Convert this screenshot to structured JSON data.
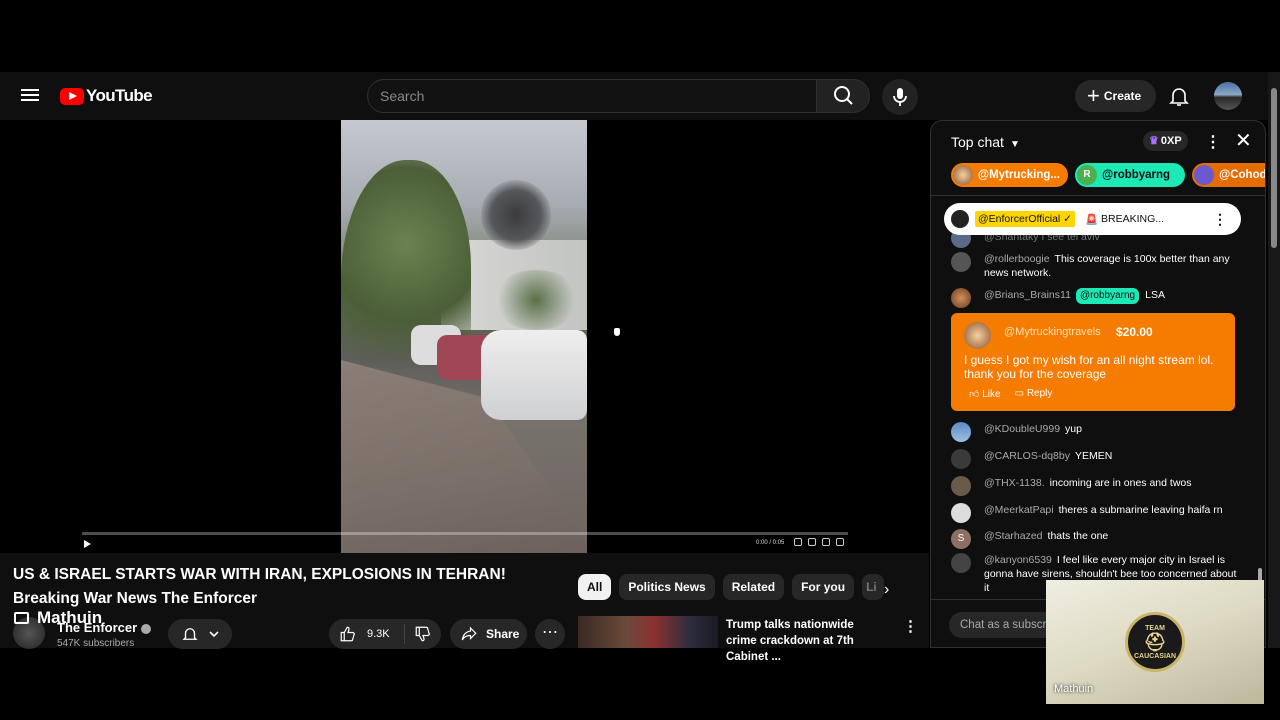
{
  "header": {
    "logo_text": "YouTube",
    "search_placeholder": "Search",
    "create_label": "Create"
  },
  "player": {
    "time": "0:00 / 0:05"
  },
  "video": {
    "title_line1": "US & ISRAEL STARTS WAR WITH IRAN, EXPLOSIONS IN TEHRAN!",
    "title_line2": "Breaking War News The Enforcer",
    "overlay_name": "Mathuin",
    "channel_name": "The Enforcer",
    "subscribers": "547K subscribers",
    "likes": "9.3K",
    "share_label": "Share"
  },
  "related": {
    "chips": [
      "All",
      "Politics News",
      "Related",
      "For you",
      "Li"
    ],
    "first_title": "Trump talks nationwide crime crackdown at 7th Cabinet ..."
  },
  "chat": {
    "title": "Top chat",
    "xp": "0XP",
    "tickers": [
      "@Mytrucking...",
      "@robbyarng",
      "@Cohode"
    ],
    "ticker_initial": "R",
    "pinned": {
      "author": "@EnforcerOfficial ✓",
      "text": "BREAKING..."
    },
    "partial_msg": "@Shantaky  I see tel aviv",
    "messages": [
      {
        "author": "@rollerboogie",
        "text": "This coverage is 100x better than any news network."
      },
      {
        "author": "@Brians_Brains11",
        "badge": "@robbyarng",
        "text": "LSA"
      },
      {
        "author": "@KDoubleU999",
        "text": "yup"
      },
      {
        "author": "@CARLOS-dq8by",
        "text": "YEMEN"
      },
      {
        "author": "@THX-1138.",
        "text": "incoming are in ones and twos"
      },
      {
        "author": "@MeerkatPapi",
        "text": "theres a submarine leaving haifa rn"
      },
      {
        "author": "@Starhazed",
        "text": "thats the one",
        "initial": "S"
      },
      {
        "author": "@kanyon6539",
        "text": "I feel like every major city in Israel is gonna have sirens, shouldn't bee too concerned about it"
      }
    ],
    "superchat": {
      "author": "@Mytruckingtravels",
      "amount": "$20.00",
      "text": "I guess I got my wish for an all night stream lol. thank you for the coverage",
      "like": "Like",
      "reply": "Reply"
    },
    "input_placeholder": "Chat as a subscriber..."
  },
  "pip": {
    "name": "Mathuin",
    "logo_top": "TEAM",
    "logo_bottom": "CAUCASIAN"
  }
}
